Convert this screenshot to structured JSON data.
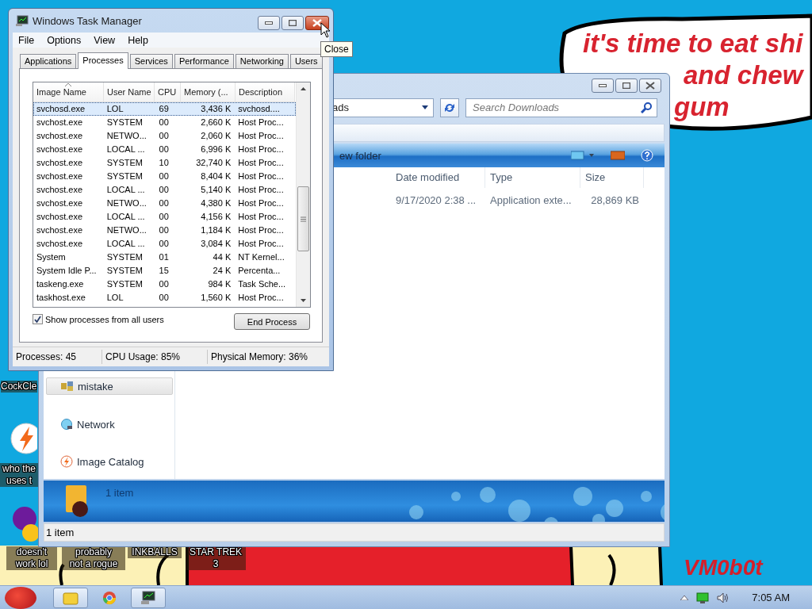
{
  "wallpaper": {
    "bubble_lines": [
      "it's time to eat shi",
      "and chew",
      "gum"
    ],
    "signature": "VM0b0t"
  },
  "desktop_icons": [
    {
      "label": "CockCle"
    },
    {
      "label": "who the\nuses t",
      "kind": "lightning"
    },
    {
      "label": "doesn't\nwork lol",
      "kind": "chat"
    },
    {
      "label": "probably\nnot a rogue"
    },
    {
      "label": "INKBALLS"
    },
    {
      "label": "STAR TREK\n3"
    }
  ],
  "explorer": {
    "address": "ads",
    "search": {
      "placeholder": "Search Downloads"
    },
    "command": "ew folder",
    "columns": [
      "Date modified",
      "Type",
      "Size"
    ],
    "row": [
      "9/17/2020 2:38 ...",
      "Application exte...",
      "28,869 KB"
    ],
    "nav": [
      {
        "label": "mistake",
        "kind": "library",
        "selected": true
      },
      {
        "label": "Network",
        "kind": "network",
        "selected": false
      },
      {
        "label": "Image Catalog",
        "kind": "lightning",
        "selected": false
      }
    ],
    "details": "1 item",
    "status": "1 item"
  },
  "task_manager": {
    "title": "Windows Task Manager",
    "menu": [
      "File",
      "Options",
      "View",
      "Help"
    ],
    "tabs": [
      {
        "label": "Applications",
        "selected": false
      },
      {
        "label": "Processes",
        "selected": true
      },
      {
        "label": "Services",
        "selected": false
      },
      {
        "label": "Performance",
        "selected": false
      },
      {
        "label": "Networking",
        "selected": false
      },
      {
        "label": "Users",
        "selected": false
      }
    ],
    "columns": [
      {
        "label": "Image Name",
        "sorted": true
      },
      {
        "label": "User Name",
        "sorted": false
      },
      {
        "label": "CPU",
        "sorted": false
      },
      {
        "label": "Memory (...",
        "sorted": false
      },
      {
        "label": "Description",
        "sorted": false
      }
    ],
    "rows": [
      {
        "cells": [
          "svchosd.exe",
          "LOL",
          "69",
          "3,436 K",
          "svchosd...."
        ],
        "selected": true
      },
      {
        "cells": [
          "svchost.exe",
          "SYSTEM",
          "00",
          "2,660 K",
          "Host Proc..."
        ],
        "selected": false
      },
      {
        "cells": [
          "svchost.exe",
          "NETWO...",
          "00",
          "2,060 K",
          "Host Proc..."
        ],
        "selected": false
      },
      {
        "cells": [
          "svchost.exe",
          "LOCAL ...",
          "00",
          "6,996 K",
          "Host Proc..."
        ],
        "selected": false
      },
      {
        "cells": [
          "svchost.exe",
          "SYSTEM",
          "10",
          "32,740 K",
          "Host Proc..."
        ],
        "selected": false
      },
      {
        "cells": [
          "svchost.exe",
          "SYSTEM",
          "00",
          "8,404 K",
          "Host Proc..."
        ],
        "selected": false
      },
      {
        "cells": [
          "svchost.exe",
          "LOCAL ...",
          "00",
          "5,140 K",
          "Host Proc..."
        ],
        "selected": false
      },
      {
        "cells": [
          "svchost.exe",
          "NETWO...",
          "00",
          "4,380 K",
          "Host Proc..."
        ],
        "selected": false
      },
      {
        "cells": [
          "svchost.exe",
          "LOCAL ...",
          "00",
          "4,156 K",
          "Host Proc..."
        ],
        "selected": false
      },
      {
        "cells": [
          "svchost.exe",
          "NETWO...",
          "00",
          "1,184 K",
          "Host Proc..."
        ],
        "selected": false
      },
      {
        "cells": [
          "svchost.exe",
          "LOCAL ...",
          "00",
          "3,084 K",
          "Host Proc..."
        ],
        "selected": false
      },
      {
        "cells": [
          "System",
          "SYSTEM",
          "01",
          "44 K",
          "NT Kernel..."
        ],
        "selected": false
      },
      {
        "cells": [
          "System Idle P...",
          "SYSTEM",
          "15",
          "24 K",
          "Percenta..."
        ],
        "selected": false
      },
      {
        "cells": [
          "taskeng.exe",
          "SYSTEM",
          "00",
          "984 K",
          "Task Sche..."
        ],
        "selected": false
      },
      {
        "cells": [
          "taskhost.exe",
          "LOL",
          "00",
          "1,560 K",
          "Host Proc..."
        ],
        "selected": false
      }
    ],
    "show_all_users": {
      "label": "Show processes from all users",
      "checked": true
    },
    "end_button": "End Process",
    "status": [
      "Processes: 45",
      "CPU Usage: 85%",
      "Physical Memory: 36%"
    ],
    "tooltip": "Close"
  },
  "taskbar": {
    "buttons": [
      {
        "kind": "folder",
        "active": true
      },
      {
        "kind": "browser",
        "active": false
      },
      {
        "kind": "monitor",
        "active": true
      }
    ],
    "clock": "7:05 AM"
  }
}
